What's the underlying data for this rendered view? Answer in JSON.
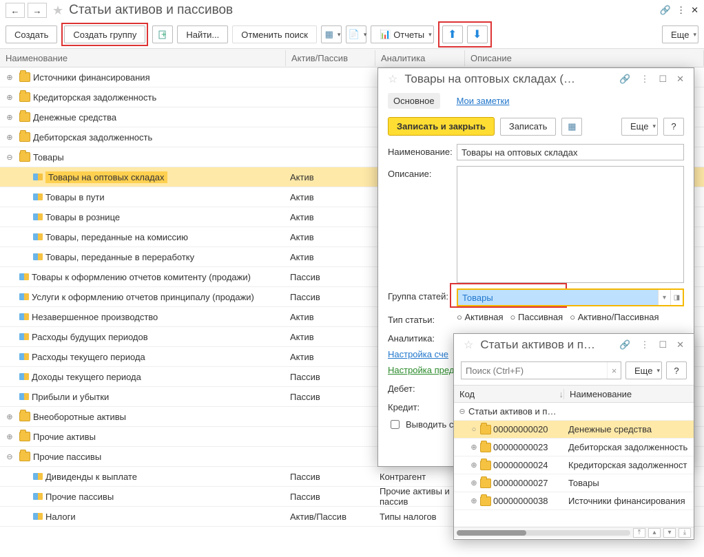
{
  "header": {
    "title": "Статьи активов и пассивов"
  },
  "toolbar": {
    "create": "Создать",
    "create_group": "Создать группу",
    "find": "Найти...",
    "cancel_find": "Отменить поиск",
    "reports": "Отчеты",
    "more": "Еще"
  },
  "columns": {
    "name": "Наименование",
    "ap": "Актив/Пассив",
    "analytics": "Аналитика",
    "desc": "Описание"
  },
  "rows": [
    {
      "lvl": 0,
      "exp": "⊕",
      "type": "folder",
      "name": "Источники финансирования"
    },
    {
      "lvl": 0,
      "exp": "⊕",
      "type": "folder",
      "name": "Кредиторская задолженность"
    },
    {
      "lvl": 0,
      "exp": "⊕",
      "type": "folder",
      "name": "Денежные средства"
    },
    {
      "lvl": 0,
      "exp": "⊕",
      "type": "folder",
      "name": "Дебиторская задолженность"
    },
    {
      "lvl": 0,
      "exp": "⊖",
      "type": "folder",
      "name": "Товары"
    },
    {
      "lvl": 1,
      "type": "item",
      "name": "Товары на оптовых складах",
      "ap": "Актив",
      "sel": true
    },
    {
      "lvl": 1,
      "type": "item",
      "name": "Товары в пути",
      "ap": "Актив"
    },
    {
      "lvl": 1,
      "type": "item",
      "name": "Товары в рознице",
      "ap": "Актив"
    },
    {
      "lvl": 1,
      "type": "item",
      "name": "Товары, переданные на комиссию",
      "ap": "Актив"
    },
    {
      "lvl": 1,
      "type": "item",
      "name": "Товары, переданные в переработку",
      "ap": "Актив"
    },
    {
      "lvl": 0,
      "type": "item",
      "name": "Товары к оформлению отчетов комитенту (продажи)",
      "ap": "Пассив"
    },
    {
      "lvl": 0,
      "type": "item",
      "name": "Услуги к оформлению отчетов принципалу (продажи)",
      "ap": "Пассив"
    },
    {
      "lvl": 0,
      "type": "item",
      "name": "Незавершенное производство",
      "ap": "Актив"
    },
    {
      "lvl": 0,
      "type": "item",
      "name": "Расходы будущих периодов",
      "ap": "Актив"
    },
    {
      "lvl": 0,
      "type": "item",
      "name": "Расходы текущего периода",
      "ap": "Актив"
    },
    {
      "lvl": 0,
      "type": "item",
      "name": "Доходы текущего периода",
      "ap": "Пассив"
    },
    {
      "lvl": 0,
      "type": "item",
      "name": "Прибыли и убытки",
      "ap": "Пассив"
    },
    {
      "lvl": 0,
      "exp": "⊕",
      "type": "folder",
      "name": "Внеоборотные активы"
    },
    {
      "lvl": 0,
      "exp": "⊕",
      "type": "folder",
      "name": "Прочие активы"
    },
    {
      "lvl": 0,
      "exp": "⊖",
      "type": "folder",
      "name": "Прочие пассивы"
    },
    {
      "lvl": 1,
      "type": "item",
      "name": "Дивиденды к выплате",
      "ap": "Пассив",
      "an": "Контрагент"
    },
    {
      "lvl": 1,
      "type": "item",
      "name": "Прочие пассивы",
      "ap": "Пассив",
      "an": "Прочие активы и пассив"
    },
    {
      "lvl": 1,
      "type": "item",
      "name": "Налоги",
      "ap": "Актив/Пассив",
      "an": "Типы налогов"
    }
  ],
  "dialog1": {
    "title": "Товары на оптовых складах (…",
    "tab_main": "Основное",
    "tab_notes": "Мои заметки",
    "save_close": "Записать и закрыть",
    "save": "Записать",
    "more": "Еще",
    "lbl_name": "Наименование:",
    "val_name": "Товары на оптовых складах",
    "lbl_desc": "Описание:",
    "lbl_group": "Группа статей:",
    "val_group": "Товары",
    "lbl_type": "Тип статьи:",
    "radio_a": "Активная",
    "radio_p": "Пассивная",
    "radio_ap": "Активно/Пассивная",
    "lbl_analytics": "Аналитика:",
    "link_accounts": "Настройка сче",
    "link_pred": "Настройка пред",
    "lbl_debit": "Дебет:",
    "lbl_credit": "Кредит:",
    "chk_output": "Выводить с"
  },
  "dialog2": {
    "title": "Статьи активов и п…",
    "search_ph": "Поиск (Ctrl+F)",
    "more": "Еще",
    "col_code": "Код",
    "col_name": "Наименование",
    "root": "Статьи активов и п…",
    "rows": [
      {
        "code": "00000000020",
        "name": "Денежные средства",
        "sel": true
      },
      {
        "code": "00000000023",
        "name": "Дебиторская задолженность"
      },
      {
        "code": "00000000024",
        "name": "Кредиторская задолженност"
      },
      {
        "code": "00000000027",
        "name": "Товары"
      },
      {
        "code": "00000000038",
        "name": "Источники финансирования"
      }
    ]
  }
}
